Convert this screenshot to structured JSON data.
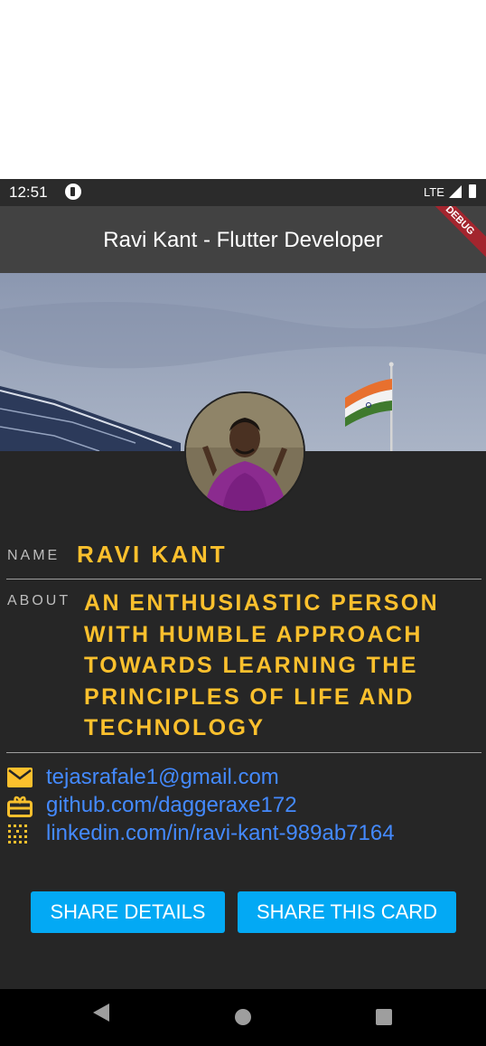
{
  "status_bar": {
    "time": "12:51",
    "network": "LTE"
  },
  "app_bar": {
    "title": "Ravi Kant - Flutter Developer",
    "debug_banner": "DEBUG"
  },
  "profile": {
    "name_label": "NAME",
    "name": "RAVI KANT",
    "about_label": "ABOUT",
    "about": "AN ENTHUSIASTIC PERSON WITH HUMBLE APPROACH TOWARDS LEARNING THE PRINCIPLES OF LIFE AND TECHNOLOGY"
  },
  "contacts": [
    {
      "icon": "email-icon",
      "text": "tejasrafale1@gmail.com"
    },
    {
      "icon": "github-icon",
      "text": "github.com/daggeraxe172"
    },
    {
      "icon": "linkedin-icon",
      "text": "linkedin.com/in/ravi-kant-989ab7164"
    }
  ],
  "buttons": {
    "share_details": "SHARE DETAILS",
    "share_card": "SHARE THIS CARD"
  },
  "colors": {
    "accent_text": "#fbc02d",
    "link": "#448aff",
    "button": "#03a9f4",
    "app_bar": "#424242",
    "background": "#262626"
  }
}
